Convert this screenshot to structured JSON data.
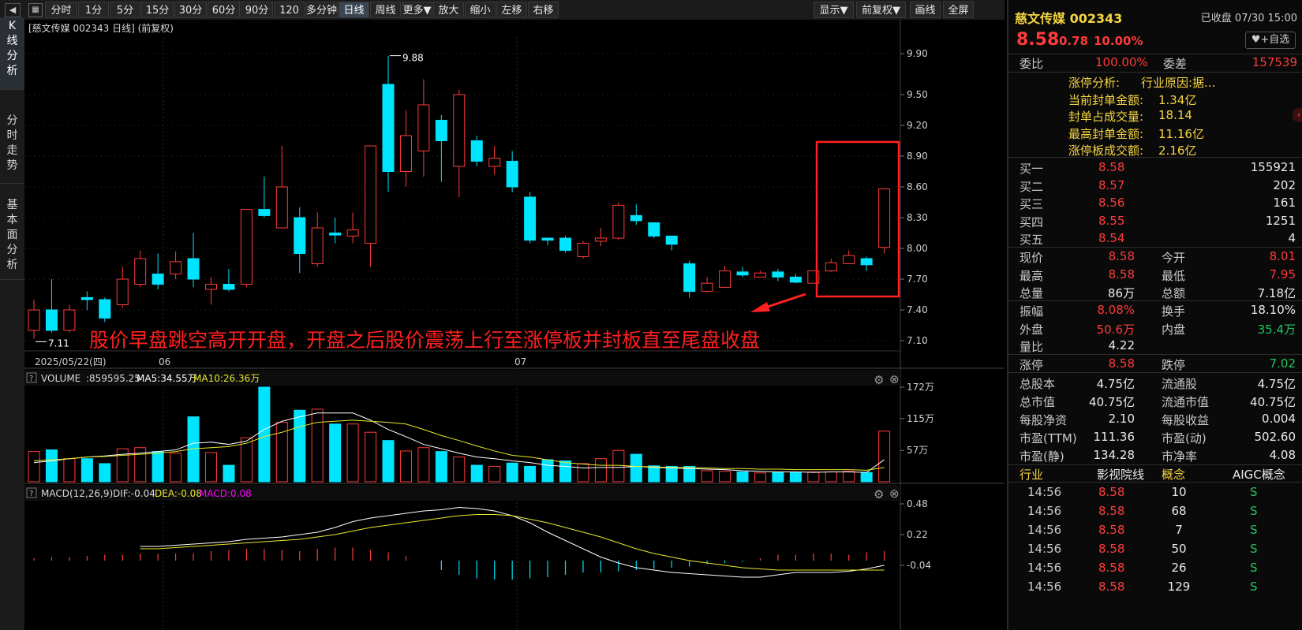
{
  "toolbar": {
    "items": [
      "分时",
      "1分",
      "5分",
      "15分",
      "30分",
      "60分",
      "90分",
      "120分",
      "多分钟",
      "日线",
      "周线",
      "更多▼",
      "放大",
      "缩小",
      "左移",
      "右移",
      "显示▼",
      "前复权▼",
      "画线",
      "全屏"
    ],
    "active": "日线"
  },
  "left_tabs": [
    "K线分析",
    "分时走势",
    "基本面分析"
  ],
  "chart": {
    "header": "[慈文传媒 002343 日线] (前复权)",
    "price_ticks": [
      "9.90",
      "9.50",
      "9.20",
      "8.90",
      "8.60",
      "8.30",
      "8.00",
      "7.70",
      "7.40",
      "7.10"
    ],
    "high_label": "9.88",
    "low_label": "7.11",
    "date_labels": [
      "2025/05/22(四)",
      "06",
      "07"
    ],
    "annotation": "股价早盘跳空高开开盘，开盘之后股价震荡上行至涨停板并封板直至尾盘收盘",
    "volume_header": {
      "name": "VOLUME",
      "value": ":859595.25",
      "ma5": "MA5:34.55万",
      "ma10": "MA10:26.36万"
    },
    "volume_ticks": [
      "172万",
      "115万",
      "57万"
    ],
    "macd_header": {
      "name": "MACD(12,26,9)",
      "dif": "DIF:-0.04",
      "dea": "DEA:-0.08",
      "macd": "MACD:0.08"
    },
    "macd_ticks": [
      "0.48",
      "0.22",
      "-0.04"
    ],
    "colors": {
      "up": "#ff3b3b",
      "down": "#00e5ff",
      "ma5": "#ffffff",
      "ma10": "#e8e82a",
      "macd": "#ff00ff",
      "box": "#ff2020"
    }
  },
  "chart_data": {
    "type": "candlestick",
    "ylim": [
      7.0,
      10.0
    ],
    "candles": [
      [
        7.2,
        7.4,
        7.12,
        7.5,
        "u"
      ],
      [
        7.4,
        7.2,
        7.18,
        7.7,
        "d"
      ],
      [
        7.2,
        7.4,
        7.18,
        7.45,
        "u"
      ],
      [
        7.5,
        7.52,
        7.4,
        7.58,
        "d"
      ],
      [
        7.5,
        7.32,
        7.28,
        7.52,
        "d"
      ],
      [
        7.45,
        7.7,
        7.42,
        7.82,
        "u"
      ],
      [
        7.65,
        7.9,
        7.62,
        7.98,
        "u"
      ],
      [
        7.75,
        7.65,
        7.6,
        7.95,
        "d"
      ],
      [
        7.75,
        7.87,
        7.7,
        7.97,
        "u"
      ],
      [
        7.9,
        7.7,
        7.62,
        8.15,
        "d"
      ],
      [
        7.6,
        7.65,
        7.45,
        7.72,
        "u"
      ],
      [
        7.65,
        7.6,
        7.58,
        7.8,
        "d"
      ],
      [
        7.65,
        8.38,
        7.62,
        8.38,
        "u"
      ],
      [
        8.38,
        8.32,
        8.3,
        8.7,
        "d"
      ],
      [
        8.2,
        8.6,
        8.2,
        9.0,
        "u"
      ],
      [
        8.3,
        7.95,
        7.76,
        8.4,
        "d"
      ],
      [
        7.85,
        8.2,
        7.82,
        8.35,
        "u"
      ],
      [
        8.15,
        8.13,
        8.05,
        8.3,
        "d"
      ],
      [
        8.12,
        8.18,
        8.05,
        8.35,
        "u"
      ],
      [
        8.05,
        9.0,
        7.82,
        9.0,
        "u"
      ],
      [
        9.6,
        8.75,
        8.55,
        9.88,
        "d"
      ],
      [
        8.75,
        9.1,
        8.6,
        9.35,
        "u"
      ],
      [
        8.95,
        9.4,
        8.7,
        9.65,
        "u"
      ],
      [
        9.25,
        9.05,
        8.65,
        9.3,
        "d"
      ],
      [
        8.8,
        9.5,
        8.5,
        9.55,
        "u"
      ],
      [
        9.05,
        8.85,
        8.8,
        9.1,
        "d"
      ],
      [
        8.8,
        8.88,
        8.72,
        9.0,
        "u"
      ],
      [
        8.85,
        8.6,
        8.55,
        8.95,
        "d"
      ],
      [
        8.5,
        8.08,
        8.05,
        8.55,
        "d"
      ],
      [
        8.1,
        8.08,
        8.03,
        8.1,
        "d"
      ],
      [
        8.1,
        7.98,
        7.96,
        8.12,
        "d"
      ],
      [
        7.92,
        8.05,
        7.9,
        8.07,
        "u"
      ],
      [
        8.07,
        8.1,
        8.02,
        8.2,
        "u"
      ],
      [
        8.1,
        8.42,
        8.08,
        8.45,
        "u"
      ],
      [
        8.32,
        8.27,
        8.23,
        8.43,
        "d"
      ],
      [
        8.25,
        8.12,
        8.1,
        8.25,
        "d"
      ],
      [
        8.12,
        8.04,
        7.98,
        8.12,
        "d"
      ],
      [
        7.85,
        7.58,
        7.52,
        7.88,
        "d"
      ],
      [
        7.58,
        7.66,
        7.57,
        7.72,
        "u"
      ],
      [
        7.62,
        7.78,
        7.62,
        7.83,
        "u"
      ],
      [
        7.77,
        7.74,
        7.72,
        7.82,
        "d"
      ],
      [
        7.72,
        7.76,
        7.72,
        7.78,
        "u"
      ],
      [
        7.77,
        7.72,
        7.68,
        7.8,
        "d"
      ],
      [
        7.72,
        7.67,
        7.66,
        7.75,
        "d"
      ],
      [
        7.66,
        7.78,
        7.66,
        7.78,
        "u"
      ],
      [
        7.78,
        7.86,
        7.77,
        7.9,
        "u"
      ],
      [
        7.85,
        7.93,
        7.85,
        7.98,
        "u"
      ],
      [
        7.9,
        7.84,
        7.78,
        7.92,
        "d"
      ],
      [
        8.01,
        8.58,
        7.95,
        8.58,
        "u"
      ]
    ],
    "volume": [
      55,
      58,
      42,
      42,
      33,
      60,
      62,
      55,
      52,
      118,
      53,
      30,
      80,
      172,
      108,
      130,
      132,
      105,
      105,
      90,
      75,
      56,
      62,
      55,
      45,
      30,
      28,
      34,
      28,
      40,
      38,
      33,
      42,
      57,
      50,
      29,
      28,
      28,
      20,
      19,
      18,
      16,
      17,
      17,
      18,
      18,
      19,
      17,
      92
    ],
    "ma5": [
      35,
      38,
      42,
      45,
      47,
      50,
      52,
      55,
      58,
      70,
      72,
      68,
      74,
      95,
      110,
      118,
      125,
      125,
      125,
      112,
      95,
      82,
      68,
      60,
      52,
      45,
      42,
      38,
      35,
      30,
      28,
      25,
      26,
      26,
      28,
      26,
      25,
      24,
      23,
      22,
      20,
      19,
      18,
      18,
      17,
      18,
      18,
      17,
      40
    ],
    "ma10": [
      38,
      40,
      42,
      45,
      46,
      48,
      50,
      52,
      55,
      60,
      62,
      64,
      70,
      82,
      90,
      100,
      108,
      110,
      112,
      110,
      108,
      105,
      95,
      84,
      75,
      65,
      56,
      48,
      45,
      40,
      35,
      32,
      30,
      30,
      28,
      27,
      26,
      26,
      25,
      24,
      24,
      23,
      23,
      22,
      22,
      22,
      22,
      21,
      26
    ],
    "dif": [
      0.12,
      0.12,
      0.13,
      0.14,
      0.15,
      0.16,
      0.18,
      0.19,
      0.2,
      0.22,
      0.24,
      0.28,
      0.33,
      0.36,
      0.38,
      0.4,
      0.42,
      0.43,
      0.45,
      0.44,
      0.42,
      0.38,
      0.32,
      0.24,
      0.17,
      0.1,
      0.03,
      -0.02,
      -0.06,
      -0.08,
      -0.1,
      -0.11,
      -0.12,
      -0.13,
      -0.14,
      -0.14,
      -0.12,
      -0.1,
      -0.1,
      -0.1,
      -0.09,
      -0.07,
      -0.04
    ],
    "dea": [
      0.1,
      0.1,
      0.11,
      0.12,
      0.13,
      0.14,
      0.15,
      0.16,
      0.17,
      0.18,
      0.2,
      0.22,
      0.25,
      0.28,
      0.3,
      0.32,
      0.34,
      0.36,
      0.38,
      0.39,
      0.39,
      0.38,
      0.35,
      0.32,
      0.28,
      0.24,
      0.2,
      0.15,
      0.1,
      0.06,
      0.03,
      0.0,
      -0.02,
      -0.04,
      -0.06,
      -0.07,
      -0.08,
      -0.08,
      -0.08,
      -0.08,
      -0.08,
      -0.08,
      -0.08
    ],
    "macd_bars": [
      0.02,
      0.03,
      0.03,
      0.04,
      0.05,
      0.05,
      0.06,
      0.06,
      0.06,
      0.06,
      0.08,
      0.09,
      0.1,
      0.1,
      0.09,
      0.08,
      0.1,
      0.11,
      0.11,
      0.09,
      0.07,
      0.04,
      0.0,
      -0.08,
      -0.12,
      -0.15,
      -0.16,
      -0.16,
      -0.15,
      -0.14,
      -0.12,
      -0.1,
      -0.1,
      -0.09,
      -0.08,
      -0.07,
      -0.06,
      -0.05,
      -0.03,
      -0.02,
      -0.01,
      0.02,
      0.05,
      0.05,
      0.06,
      0.06,
      0.05,
      0.07,
      0.08
    ]
  },
  "panel": {
    "title": "慈文传媒 002343",
    "status": "已收盘 07/30 15:00",
    "price": "8.58",
    "change": "0.78",
    "pct": "10.00%",
    "fav_button": "+自选",
    "weibi_label": "委比",
    "weibi_value": "100.00%",
    "weicha_label": "委差",
    "weicha_value": "157539",
    "limit_info": [
      [
        "涨停分析:",
        "行业原因:据..."
      ],
      [
        "当前封单金额:",
        "1.34亿"
      ],
      [
        "封单占成交量:",
        "18.14"
      ],
      [
        "最高封单金额:",
        "11.16亿"
      ],
      [
        "涨停板成交额:",
        "2.16亿"
      ]
    ],
    "bids": [
      [
        "买一",
        "8.58",
        "155921"
      ],
      [
        "买二",
        "8.57",
        "202"
      ],
      [
        "买三",
        "8.56",
        "161"
      ],
      [
        "买四",
        "8.55",
        "1251"
      ],
      [
        "买五",
        "8.54",
        "4"
      ]
    ],
    "quote1": [
      [
        "现价",
        "8.58",
        "今开",
        "8.01"
      ],
      [
        "最高",
        "8.58",
        "最低",
        "7.95"
      ],
      [
        "总量",
        "86万",
        "总额",
        "7.18亿"
      ]
    ],
    "quote2": [
      [
        "振幅",
        "8.08%",
        "换手",
        "18.10%"
      ],
      [
        "外盘",
        "50.6万",
        "内盘",
        "35.4万"
      ],
      [
        "量比",
        "4.22",
        "",
        ""
      ]
    ],
    "limits": [
      "涨停",
      "8.58",
      "跌停",
      "7.02"
    ],
    "fundamentals": [
      [
        "总股本",
        "4.75亿",
        "流通股",
        "4.75亿"
      ],
      [
        "总市值",
        "40.75亿",
        "流通市值",
        "40.75亿"
      ],
      [
        "每股净资",
        "2.10",
        "每股收益",
        "0.004"
      ],
      [
        "市盈(TTM)",
        "111.36",
        "市盈(动)",
        "502.60"
      ],
      [
        "市盈(静)",
        "134.28",
        "市净率",
        "4.08"
      ]
    ],
    "industry": [
      "行业",
      "影视院线",
      "概念",
      "AIGC概念"
    ],
    "trades": [
      [
        "14:56",
        "8.58",
        "10",
        "S"
      ],
      [
        "14:56",
        "8.58",
        "68",
        "S"
      ],
      [
        "14:56",
        "8.58",
        "7",
        "S"
      ],
      [
        "14:56",
        "8.58",
        "50",
        "S"
      ],
      [
        "14:56",
        "8.58",
        "26",
        "S"
      ],
      [
        "14:56",
        "8.58",
        "129",
        "S"
      ]
    ]
  }
}
